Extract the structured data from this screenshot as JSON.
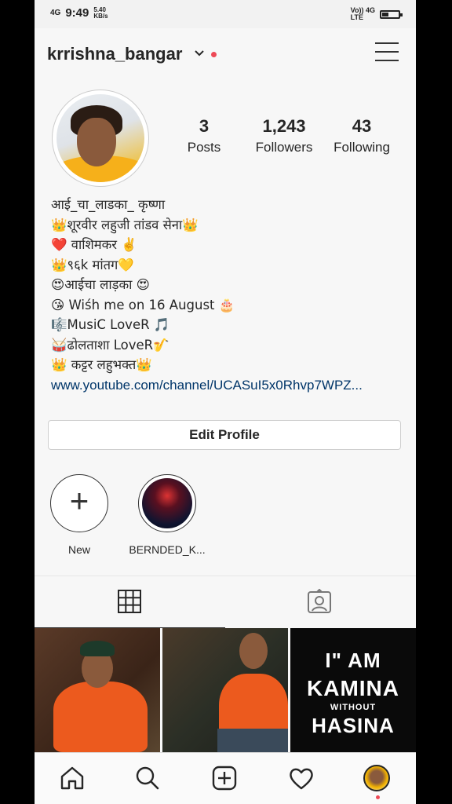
{
  "status_bar": {
    "network": "4G",
    "time": "9:49",
    "speed_value": "5.40",
    "speed_unit": "KB/s",
    "right_network": "Vo)) 4G",
    "right_lte": "LTE"
  },
  "header": {
    "username": "krrishna_bangar"
  },
  "stats": {
    "posts_count": "3",
    "posts_label": "Posts",
    "followers_count": "1,243",
    "followers_label": "Followers",
    "following_count": "43",
    "following_label": "Following"
  },
  "bio": {
    "lines": [
      "आई_चा_लाडका_ कृष्णा",
      "👑शूरवीर लहुजी तांडव सेना👑",
      "❤️  वाशिमकर ✌️",
      "👑९६k मांतग💛",
      " 😍आईचा लाड़का 😍",
      "😘 Wiśh me on 16 August 🎂",
      "🎼MusiC LoveR 🎵",
      "🥁ढोलताशा LoveR🎷",
      "👑 कट्टर लहुभक्त👑"
    ],
    "link": "www.youtube.com/channel/UCASuI5x0Rhvp7WPZ..."
  },
  "edit_profile_label": "Edit Profile",
  "highlights": [
    {
      "label": "New"
    },
    {
      "label": "BERNDED_K..."
    }
  ],
  "posts": [
    {
      "caption": ""
    },
    {
      "caption": ""
    },
    {
      "line1": "I\" AM",
      "line2": "KAMINA",
      "line3": "WITHOUT",
      "line4": "HASINA"
    }
  ]
}
